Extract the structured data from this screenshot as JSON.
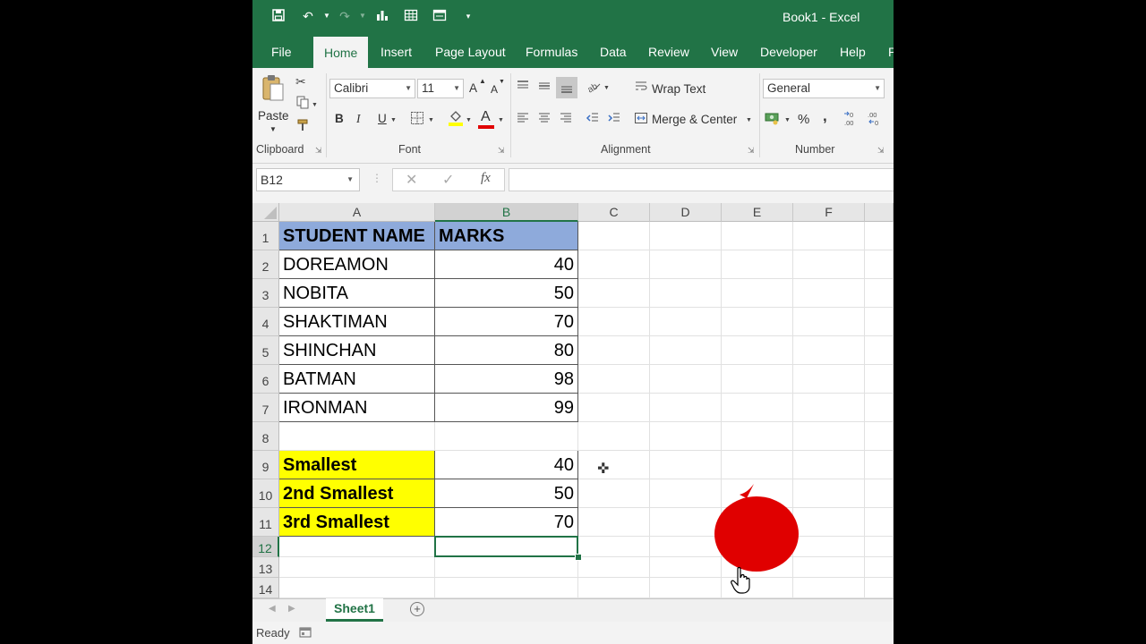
{
  "window": {
    "title": "Book1  -  Excel"
  },
  "tabs": [
    "File",
    "Home",
    "Insert",
    "Page Layout",
    "Formulas",
    "Data",
    "Review",
    "View",
    "Developer",
    "Help",
    "P"
  ],
  "active_tab": "Home",
  "ribbon": {
    "clipboard": {
      "paste_label": "Paste",
      "group_label": "Clipboard"
    },
    "font": {
      "font_name": "Calibri",
      "font_size": "11",
      "grow": "A",
      "shrink": "A",
      "bold": "B",
      "italic": "I",
      "underline": "U",
      "font_color_glyph": "A",
      "group_label": "Font"
    },
    "alignment": {
      "wrap_text": "Wrap Text",
      "merge_center": "Merge & Center",
      "group_label": "Alignment"
    },
    "number": {
      "format": "General",
      "percent": "%",
      "comma": ",",
      "group_label": "Number"
    }
  },
  "formula_bar": {
    "name_box": "B12",
    "fx": "fx",
    "formula": ""
  },
  "sheet": {
    "columns": [
      "A",
      "B",
      "C",
      "D",
      "E",
      "F"
    ],
    "rows": [
      "1",
      "2",
      "3",
      "4",
      "5",
      "6",
      "7",
      "8",
      "9",
      "10",
      "11",
      "12",
      "13",
      "14"
    ],
    "header": [
      "STUDENT NAME",
      "MARKS"
    ],
    "students": [
      {
        "name": "DOREAMON",
        "marks": "40"
      },
      {
        "name": "NOBITA",
        "marks": "50"
      },
      {
        "name": "SHAKTIMAN",
        "marks": "70"
      },
      {
        "name": "SHINCHAN",
        "marks": "80"
      },
      {
        "name": "BATMAN",
        "marks": "98"
      },
      {
        "name": "IRONMAN",
        "marks": "99"
      }
    ],
    "summary": [
      {
        "label": "Smallest",
        "value": "40"
      },
      {
        "label": "2nd Smallest",
        "value": "50"
      },
      {
        "label": "3rd Smallest",
        "value": "70"
      }
    ],
    "selected_cell": "B12",
    "active_sheet": "Sheet1"
  },
  "status": {
    "text": "Ready"
  },
  "colors": {
    "excel_green": "#217346",
    "header_fill": "#8eaadb",
    "highlight_fill": "#ffff00",
    "overlay_red": "#e00000"
  },
  "icons": [
    "save-icon",
    "undo-icon",
    "redo-icon",
    "chart-icon",
    "table-icon",
    "form-icon",
    "customize-icon",
    "cut-icon",
    "copy-icon",
    "format-painter-icon",
    "borders-icon",
    "fill-color-icon",
    "orientation-icon",
    "indent-icon",
    "currency-icon",
    "cross-cursor-icon",
    "hand-cursor-icon"
  ]
}
